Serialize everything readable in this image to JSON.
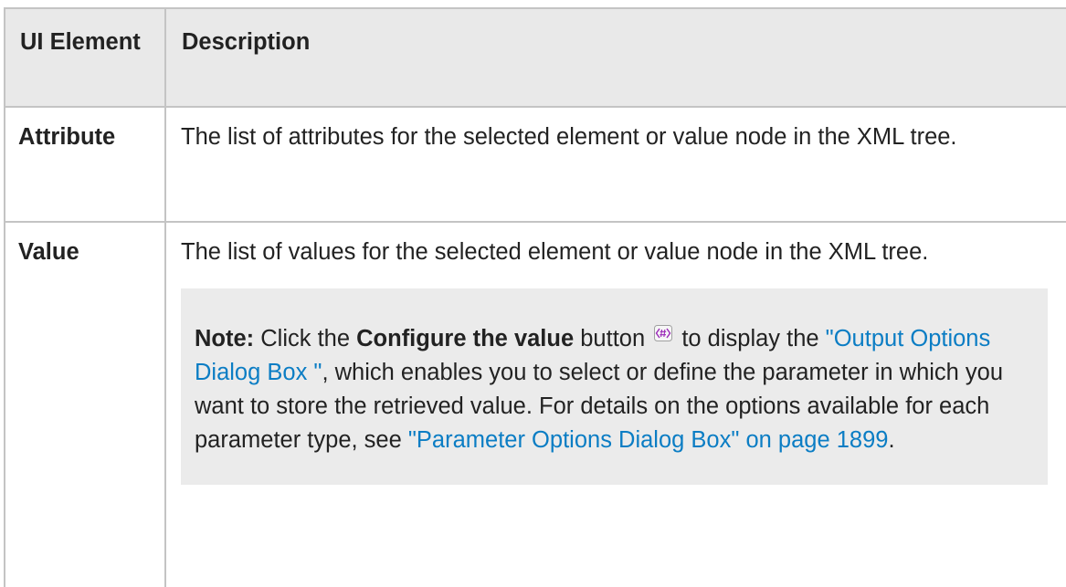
{
  "table": {
    "header": {
      "col1": "UI Element",
      "col2": "Description"
    },
    "rows": [
      {
        "name": "Attribute",
        "description": "The list of attributes for the selected element or value node in the XML tree."
      },
      {
        "name": "Value",
        "description": "The list of values for the selected element or value node in the XML tree.",
        "note": {
          "label": "Note:",
          "text1": " Click the ",
          "button_name": "Configure the value",
          "text2": " button ",
          "text3": " to display the ",
          "link1": "\"Output Options Dialog Box \"",
          "text4": ", which enables you to select or define the parameter in which you want to store the retrieved value. For details on the options available for each parameter type, see ",
          "link2": "\"Parameter Options Dialog Box\" on page 1899",
          "text5": "."
        }
      }
    ]
  },
  "icons": {
    "configure_value": "configure-value-icon"
  },
  "colors": {
    "link": "#0b7dc4",
    "note_background": "#ebebeb",
    "header_background": "#e9e9e9",
    "border": "#c4c4c4"
  }
}
